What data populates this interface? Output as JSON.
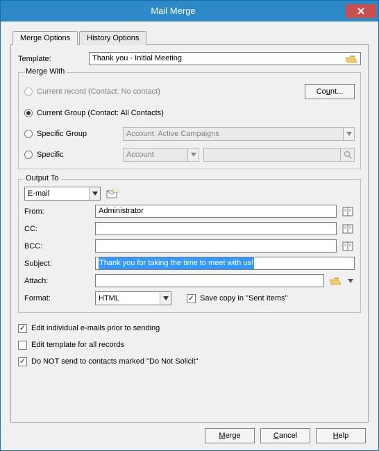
{
  "window": {
    "title": "Mail Merge"
  },
  "tabs": {
    "active": "Merge Options",
    "inactive": "History Options"
  },
  "template": {
    "label": "Template:",
    "value": "Thank you - Initial Meeting"
  },
  "mergeWith": {
    "legend": "Merge With",
    "currentRecord": {
      "label": "Current record (Contact: No contact)",
      "checked": false,
      "enabled": false
    },
    "countBtn": "Count...",
    "currentGroup": {
      "label": "Current Group (Contact: All Contacts)",
      "checked": true
    },
    "specificGroup": {
      "label": "Specific Group",
      "checked": false,
      "combo": "Account: Active Campaigns"
    },
    "specific": {
      "label": "Specific",
      "checked": false,
      "combo": "Account",
      "search": ""
    }
  },
  "outputTo": {
    "legend": "Output To",
    "combo": "E-mail",
    "from": {
      "label": "From:",
      "value": "Administrator"
    },
    "cc": {
      "label": "CC:",
      "value": ""
    },
    "bcc": {
      "label": "BCC:",
      "value": ""
    },
    "subject": {
      "label": "Subject:",
      "value": "Thank you for taking the time to meet with us!"
    },
    "attach": {
      "label": "Attach:",
      "value": ""
    },
    "format": {
      "label": "Format:",
      "value": "HTML"
    },
    "saveCopy": {
      "label": "Save copy in \"Sent Items\"",
      "checked": true
    }
  },
  "options": {
    "editIndividual": {
      "label": "Edit individual e-mails prior to sending",
      "checked": true
    },
    "editTemplate": {
      "label": "Edit template for all records",
      "checked": false
    },
    "doNotSolicit": {
      "label": "Do NOT send to contacts marked \"Do Not Solicit\"",
      "checked": true
    }
  },
  "actions": {
    "merge": "Merge",
    "cancel": "Cancel",
    "help": "Help"
  },
  "icons": {
    "close": "close-icon",
    "folderOpen": "folder-open-icon",
    "envelope": "envelope-icon",
    "addressBook": "address-book-icon",
    "magnifier": "magnifier-icon",
    "chevronDown": "chevron-down-icon"
  }
}
